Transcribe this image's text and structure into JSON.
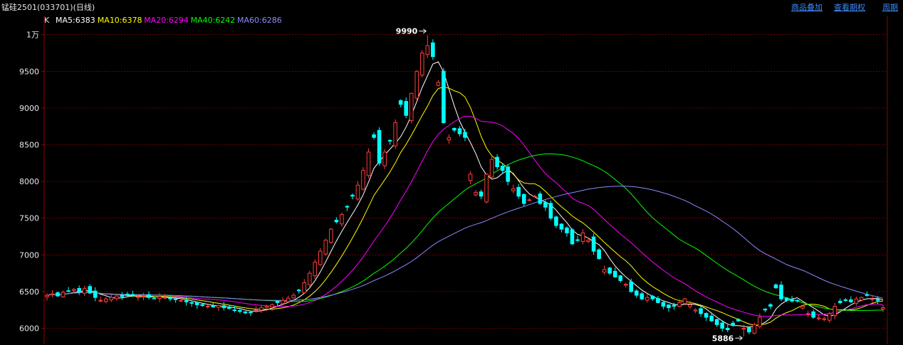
{
  "header": {
    "title": "锰硅2501(033701)(日线)",
    "links": [
      "商品叠加",
      "查看期权",
      "周期"
    ]
  },
  "colors": {
    "background": "#000000",
    "grid": "#8b0000",
    "up": "#ff3c3c",
    "down": "#00ffff",
    "ma5": "#ffffff",
    "ma10": "#ffff00",
    "ma20": "#ff00ff",
    "ma40": "#00ff00",
    "ma60": "#8a8aff"
  },
  "chart_data": {
    "type": "candlestick",
    "legend_prefix": "K",
    "ylim": [
      5800,
      10200
    ],
    "y_ticks": [
      6000,
      6500,
      7000,
      7500,
      8000,
      8500,
      9000,
      9500,
      10000
    ],
    "y_tick_labels": [
      "6000",
      "6500",
      "7000",
      "7500",
      "8000",
      "8500",
      "9000",
      "9500",
      "1万"
    ],
    "grid": true,
    "ma_legend": [
      {
        "name": "MA5",
        "value": 6383,
        "label": "MA5:6383"
      },
      {
        "name": "MA10",
        "value": 6378,
        "label": "MA10:6378"
      },
      {
        "name": "MA20",
        "value": 6294,
        "label": "MA20:6294"
      },
      {
        "name": "MA40",
        "value": 6242,
        "label": "MA40:6242"
      },
      {
        "name": "MA60",
        "value": 6286,
        "label": "MA60:6286"
      }
    ],
    "annotations": [
      {
        "label": "9990",
        "value": 9990,
        "kind": "high"
      },
      {
        "label": "5886",
        "value": 5886,
        "kind": "low"
      }
    ],
    "closes": [
      6450,
      6470,
      6440,
      6490,
      6510,
      6530,
      6500,
      6540,
      6480,
      6420,
      6380,
      6400,
      6420,
      6440,
      6430,
      6450,
      6460,
      6430,
      6440,
      6420,
      6410,
      6430,
      6420,
      6400,
      6390,
      6380,
      6360,
      6340,
      6320,
      6310,
      6300,
      6290,
      6310,
      6280,
      6270,
      6250,
      6230,
      6210,
      6220,
      6250,
      6280,
      6300,
      6320,
      6350,
      6380,
      6410,
      6450,
      6520,
      6620,
      6750,
      6900,
      7050,
      7200,
      7350,
      7450,
      7550,
      7650,
      7800,
      7950,
      8150,
      8400,
      8600,
      8250,
      8400,
      8550,
      8800,
      9050,
      8900,
      9200,
      9500,
      9750,
      9850,
      9700,
      9350,
      8800,
      8600,
      8700,
      8650,
      8600,
      8100,
      7850,
      7800,
      8100,
      8300,
      8200,
      8150,
      8000,
      7900,
      7800,
      7700,
      7750,
      7800,
      7700,
      7650,
      7500,
      7400,
      7350,
      7300,
      7150,
      7200,
      7300,
      7200,
      7050,
      6950,
      6800,
      6750,
      6700,
      6650,
      6600,
      6500,
      6450,
      6400,
      6420,
      6400,
      6350,
      6300,
      6280,
      6300,
      6350,
      6400,
      6320,
      6250,
      6200,
      6150,
      6100,
      6050,
      6000,
      5980,
      6050,
      6100,
      6000,
      5950,
      6050,
      6150,
      6250,
      6300,
      6550,
      6400,
      6380,
      6370,
      6380,
      6300,
      6200,
      6150,
      6140,
      6130,
      6200,
      6300,
      6350,
      6380,
      6360,
      6400,
      6420,
      6450,
      6400,
      6380,
      6280
    ],
    "high_index": 71,
    "high_value": 9990,
    "low_index": 130,
    "low_value": 5886
  }
}
